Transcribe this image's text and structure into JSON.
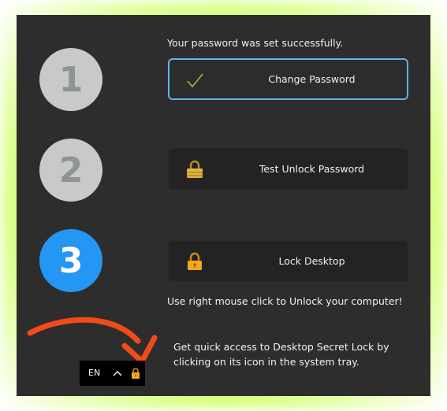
{
  "steps": [
    {
      "number": "1",
      "state": "done"
    },
    {
      "number": "2",
      "state": "done"
    },
    {
      "number": "3",
      "state": "active"
    }
  ],
  "status_message": "Your password was set successfully.",
  "buttons": {
    "change_password": {
      "label": "Change Password",
      "icon": "check-icon"
    },
    "test_unlock": {
      "label": "Test Unlock Password",
      "icon": "gold-lock-icon"
    },
    "lock_desktop": {
      "label": "Lock Desktop",
      "icon": "orange-lock-icon"
    }
  },
  "unlock_hint": "Use right mouse click to Unlock your computer!",
  "tray": {
    "language": "EN",
    "chevron_icon": "chevron-up-icon",
    "app_icon": "orange-lock-icon"
  },
  "tray_tip": "Get quick access to Desktop Secret Lock by clicking on its icon in the system tray.",
  "colors": {
    "panel_bg": "#2d2d2d",
    "accent_blue": "#2496f3",
    "selected_border": "#5fb6ea",
    "arrow": "#f24a1b",
    "check": "#8bc34a"
  }
}
